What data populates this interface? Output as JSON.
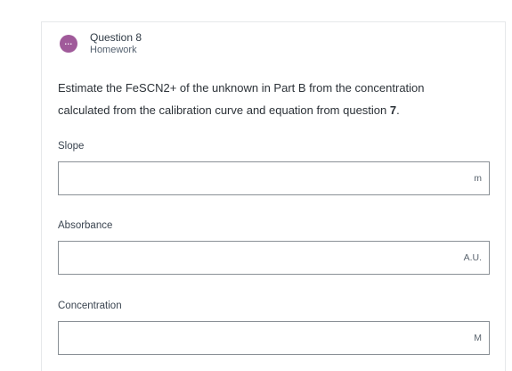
{
  "question": {
    "avatar_icon": "ellipsis-icon",
    "avatar_glyph": "...",
    "avatar_color": "#a05a9a",
    "title": "Question 8",
    "subtitle": "Homework",
    "prompt_main": "Estimate the FeSCN2+ of the unknown in Part B from the concentration calculated from the calibration curve and equation from question ",
    "prompt_number": "7",
    "prompt_end": "."
  },
  "fields": {
    "slope": {
      "label": "Slope",
      "value": "",
      "unit": "m"
    },
    "absorbance": {
      "label": "Absorbance",
      "value": "",
      "unit": "A.U."
    },
    "concentration": {
      "label": "Concentration",
      "value": "",
      "unit": "M"
    }
  }
}
